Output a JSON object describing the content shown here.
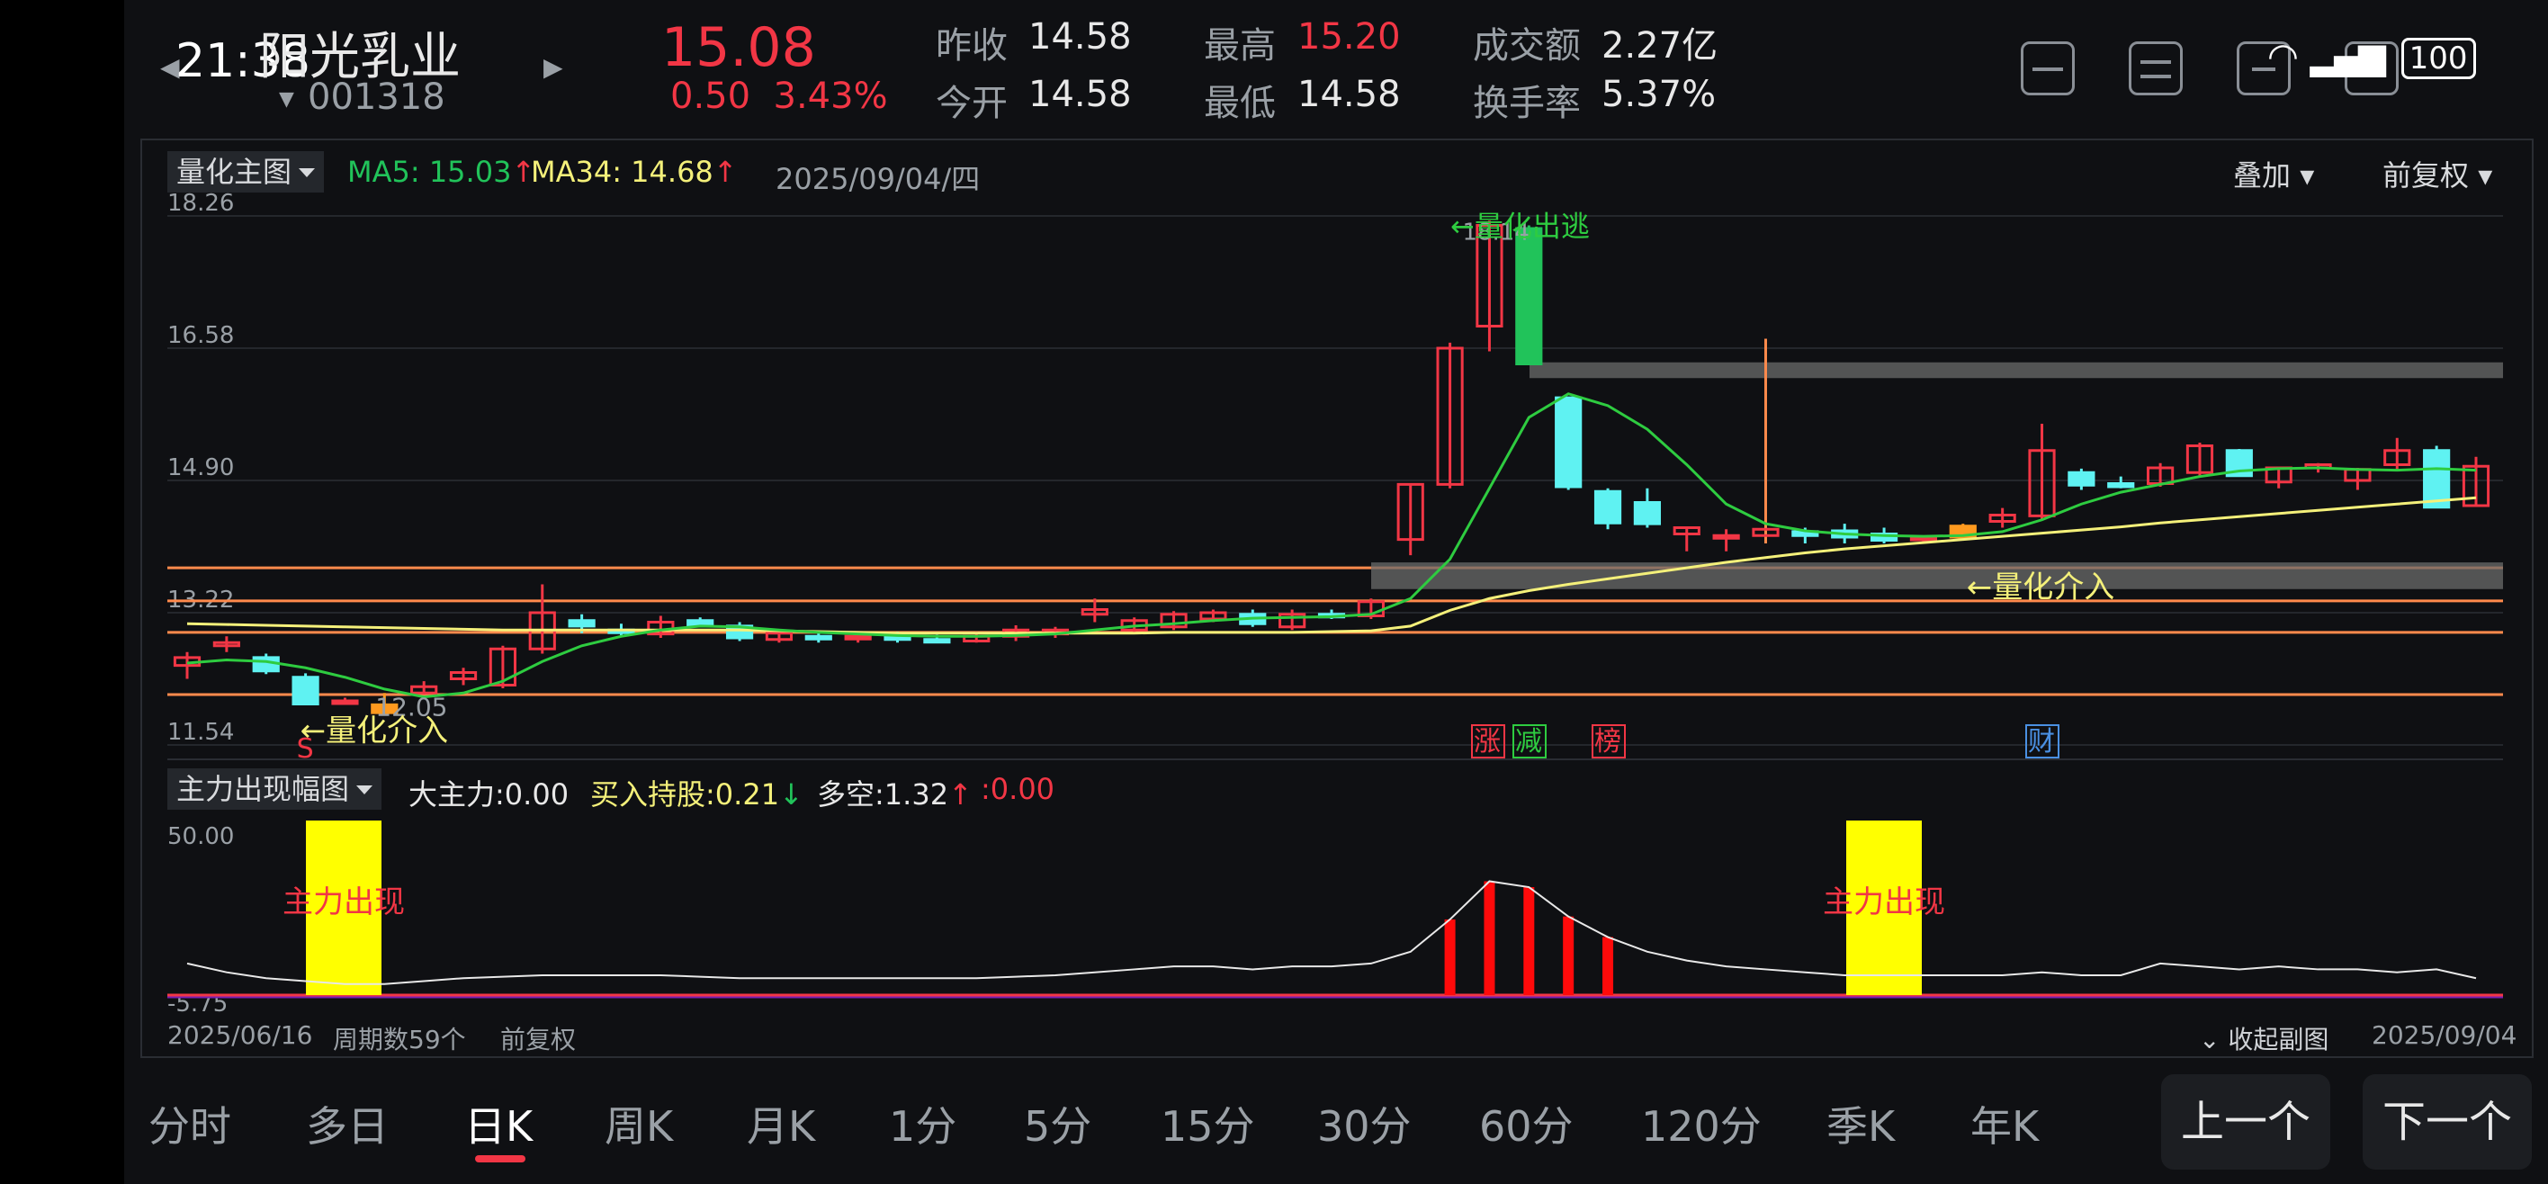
{
  "status": {
    "time": "21:38",
    "battery": "100"
  },
  "stock": {
    "name": "阳光乳业",
    "code": "001318",
    "price": "15.08",
    "change": "0.50",
    "change_pct": "3.43%"
  },
  "quote": {
    "prev_close_label": "昨收",
    "prev_close": "14.58",
    "open_label": "今开",
    "open": "14.58",
    "high_label": "最高",
    "high": "15.20",
    "low_label": "最低",
    "low": "14.58",
    "turnover_amt_label": "成交额",
    "turnover_amt": "2.27亿",
    "turnover_rate_label": "换手率",
    "turnover_rate": "5.37%"
  },
  "main_chart": {
    "indicator": "量化主图",
    "ma5_label": "MA5: 15.03",
    "ma5_arrow": "↑",
    "ma34_label": "MA34: 14.68",
    "ma34_arrow": "↑",
    "date": "2025/09/04/四",
    "overlay": "叠加",
    "adjust": "前复权",
    "y_ticks": [
      "18.26",
      "16.58",
      "14.90",
      "13.22",
      "11.54"
    ],
    "low_marker": "12.05",
    "high_marker": "18.14",
    "signal_buy": "←量化介入",
    "signal_sell": "←量化出逃",
    "s_marker": "S",
    "event_tags": [
      "涨",
      "减",
      "榜",
      "财"
    ]
  },
  "sub_chart": {
    "indicator": "主力出现幅图",
    "big_force_label": "大主力:",
    "big_force": "0.00",
    "buy_hold_label": "买入持股:",
    "buy_hold": "0.21",
    "buy_hold_arrow": "↓",
    "long_short_label": "多空:",
    "long_short": "1.32",
    "long_short_arrow": "↑",
    "extra": ":0.00",
    "y_top": "50.00",
    "y_bottom": "-5.75",
    "signal_text": "主力出现"
  },
  "footer": {
    "start_date": "2025/06/16",
    "periods": "周期数59个",
    "adjust": "前复权",
    "collapse": "收起副图",
    "end_date": "2025/09/04"
  },
  "tabs": [
    "分时",
    "多日",
    "日K",
    "周K",
    "月K",
    "1分",
    "5分",
    "15分",
    "30分",
    "60分",
    "120分",
    "季K",
    "年K"
  ],
  "nav": {
    "prev": "上一个",
    "next": "下一个"
  },
  "colors": {
    "up": "#f23645",
    "down": "#5ff2f2",
    "ma5": "#2ecc40",
    "ma34": "#f4f07a",
    "accent": "#f23645"
  },
  "chart_data": {
    "type": "candlestick",
    "x_range": [
      "2025/06/16",
      "2025/09/04"
    ],
    "periods": 59,
    "ylim": [
      11.54,
      18.26
    ],
    "candles": [
      {
        "o": 12.55,
        "h": 12.72,
        "l": 12.38,
        "c": 12.65
      },
      {
        "o": 12.8,
        "h": 12.92,
        "l": 12.72,
        "c": 12.84
      },
      {
        "o": 12.65,
        "h": 12.7,
        "l": 12.44,
        "c": 12.48
      },
      {
        "o": 12.4,
        "h": 12.45,
        "l": 12.06,
        "c": 12.06
      },
      {
        "o": 12.1,
        "h": 12.14,
        "l": 12.05,
        "c": 12.1
      },
      {
        "o": 12.05,
        "h": 12.2,
        "l": 12.0,
        "c": 11.95
      },
      {
        "o": 12.2,
        "h": 12.35,
        "l": 12.18,
        "c": 12.28
      },
      {
        "o": 12.38,
        "h": 12.52,
        "l": 12.3,
        "c": 12.46
      },
      {
        "o": 12.3,
        "h": 12.8,
        "l": 12.26,
        "c": 12.76
      },
      {
        "o": 12.76,
        "h": 13.58,
        "l": 12.7,
        "c": 13.22
      },
      {
        "o": 13.12,
        "h": 13.2,
        "l": 12.96,
        "c": 13.05
      },
      {
        "o": 13.0,
        "h": 13.08,
        "l": 12.92,
        "c": 12.98
      },
      {
        "o": 12.95,
        "h": 13.18,
        "l": 12.9,
        "c": 13.1
      },
      {
        "o": 13.12,
        "h": 13.16,
        "l": 13.04,
        "c": 13.06
      },
      {
        "o": 13.05,
        "h": 13.1,
        "l": 12.86,
        "c": 12.9
      },
      {
        "o": 12.88,
        "h": 13.0,
        "l": 12.84,
        "c": 12.96
      },
      {
        "o": 12.92,
        "h": 12.98,
        "l": 12.84,
        "c": 12.9
      },
      {
        "o": 12.9,
        "h": 12.96,
        "l": 12.84,
        "c": 12.92
      },
      {
        "o": 12.92,
        "h": 12.98,
        "l": 12.84,
        "c": 12.88
      },
      {
        "o": 12.88,
        "h": 12.94,
        "l": 12.84,
        "c": 12.86
      },
      {
        "o": 12.86,
        "h": 12.98,
        "l": 12.84,
        "c": 12.92
      },
      {
        "o": 12.92,
        "h": 13.06,
        "l": 12.86,
        "c": 13.0
      },
      {
        "o": 12.95,
        "h": 13.04,
        "l": 12.9,
        "c": 13.0
      },
      {
        "o": 13.2,
        "h": 13.4,
        "l": 13.1,
        "c": 13.26
      },
      {
        "o": 13.0,
        "h": 13.16,
        "l": 12.96,
        "c": 13.12
      },
      {
        "o": 13.04,
        "h": 13.24,
        "l": 13.0,
        "c": 13.2
      },
      {
        "o": 13.14,
        "h": 13.26,
        "l": 13.1,
        "c": 13.22
      },
      {
        "o": 13.2,
        "h": 13.26,
        "l": 13.04,
        "c": 13.08
      },
      {
        "o": 13.04,
        "h": 13.26,
        "l": 13.0,
        "c": 13.2
      },
      {
        "o": 13.2,
        "h": 13.26,
        "l": 13.14,
        "c": 13.18
      },
      {
        "o": 13.18,
        "h": 13.4,
        "l": 13.14,
        "c": 13.36
      },
      {
        "o": 14.15,
        "h": 14.85,
        "l": 13.95,
        "c": 14.85
      },
      {
        "o": 14.85,
        "h": 16.65,
        "l": 14.8,
        "c": 16.58
      },
      {
        "o": 16.86,
        "h": 18.2,
        "l": 16.54,
        "c": 18.14
      },
      {
        "o": 18.1,
        "h": 18.14,
        "l": 16.38,
        "c": 16.38
      },
      {
        "o": 15.95,
        "h": 15.95,
        "l": 14.78,
        "c": 14.82
      },
      {
        "o": 14.76,
        "h": 14.8,
        "l": 14.28,
        "c": 14.36
      },
      {
        "o": 14.62,
        "h": 14.8,
        "l": 14.3,
        "c": 14.35
      },
      {
        "o": 14.22,
        "h": 14.3,
        "l": 14.0,
        "c": 14.3
      },
      {
        "o": 14.2,
        "h": 14.28,
        "l": 14.0,
        "c": 14.2
      },
      {
        "o": 14.2,
        "h": 16.7,
        "l": 14.1,
        "c": 14.28
      },
      {
        "o": 14.25,
        "h": 14.3,
        "l": 14.1,
        "c": 14.2
      },
      {
        "o": 14.26,
        "h": 14.35,
        "l": 14.1,
        "c": 14.18
      },
      {
        "o": 14.22,
        "h": 14.3,
        "l": 14.1,
        "c": 14.14
      },
      {
        "o": 14.18,
        "h": 14.2,
        "l": 14.1,
        "c": 14.18
      },
      {
        "o": 14.18,
        "h": 14.35,
        "l": 14.15,
        "c": 14.32
      },
      {
        "o": 14.38,
        "h": 14.55,
        "l": 14.3,
        "c": 14.46
      },
      {
        "o": 14.45,
        "h": 15.62,
        "l": 14.4,
        "c": 15.28
      },
      {
        "o": 15.0,
        "h": 15.05,
        "l": 14.78,
        "c": 14.84
      },
      {
        "o": 14.86,
        "h": 14.95,
        "l": 14.8,
        "c": 14.82
      },
      {
        "o": 14.86,
        "h": 15.12,
        "l": 14.82,
        "c": 15.06
      },
      {
        "o": 15.0,
        "h": 15.38,
        "l": 14.95,
        "c": 15.34
      },
      {
        "o": 15.28,
        "h": 15.3,
        "l": 14.95,
        "c": 14.96
      },
      {
        "o": 14.88,
        "h": 15.06,
        "l": 14.8,
        "c": 15.06
      },
      {
        "o": 15.06,
        "h": 15.12,
        "l": 15.0,
        "c": 15.1
      },
      {
        "o": 14.9,
        "h": 15.06,
        "l": 14.78,
        "c": 15.04
      },
      {
        "o": 15.1,
        "h": 15.44,
        "l": 15.04,
        "c": 15.28
      },
      {
        "o": 15.28,
        "h": 15.34,
        "l": 14.56,
        "c": 14.56
      },
      {
        "o": 14.58,
        "h": 15.2,
        "l": 14.58,
        "c": 15.08
      }
    ],
    "ma5": [
      12.58,
      12.62,
      12.6,
      12.52,
      12.4,
      12.25,
      12.15,
      12.2,
      12.35,
      12.6,
      12.8,
      12.92,
      13.0,
      13.05,
      13.04,
      13.0,
      12.97,
      12.95,
      12.93,
      12.92,
      12.92,
      12.93,
      12.95,
      13.0,
      13.05,
      13.08,
      13.12,
      13.15,
      13.16,
      13.17,
      13.2,
      13.4,
      13.9,
      14.8,
      15.7,
      16.0,
      15.85,
      15.55,
      15.1,
      14.6,
      14.35,
      14.26,
      14.22,
      14.2,
      14.19,
      14.2,
      14.25,
      14.4,
      14.6,
      14.75,
      14.85,
      14.95,
      15.02,
      15.05,
      15.06,
      15.04,
      15.03,
      15.05,
      15.03
    ],
    "ma34": [
      13.08,
      13.07,
      13.06,
      13.05,
      13.04,
      13.03,
      13.02,
      13.01,
      13.0,
      13.0,
      13.0,
      13.0,
      13.0,
      13.0,
      13.0,
      12.99,
      12.98,
      12.97,
      12.96,
      12.96,
      12.96,
      12.96,
      12.96,
      12.96,
      12.96,
      12.97,
      12.97,
      12.97,
      12.97,
      12.98,
      12.99,
      13.05,
      13.25,
      13.4,
      13.5,
      13.58,
      13.65,
      13.72,
      13.79,
      13.86,
      13.92,
      13.98,
      14.03,
      14.07,
      14.11,
      14.15,
      14.19,
      14.23,
      14.27,
      14.31,
      14.36,
      14.4,
      14.44,
      14.48,
      14.52,
      14.56,
      14.6,
      14.64,
      14.68
    ],
    "support_levels": [
      13.79,
      13.37,
      12.97,
      12.18
    ],
    "sub_values": [
      5,
      2,
      0,
      -1,
      -2,
      -2,
      -1,
      0,
      0.5,
      1,
      1,
      1,
      1,
      0.5,
      0,
      0,
      0,
      0,
      0,
      0,
      0,
      0.5,
      1,
      2,
      3,
      4,
      4,
      3,
      4,
      4,
      5,
      9,
      20,
      33,
      31,
      21,
      14,
      9,
      6,
      4,
      3,
      2,
      1,
      1,
      1,
      1,
      1,
      2,
      1,
      1,
      5,
      4,
      3,
      4,
      3,
      3,
      2,
      3,
      0
    ],
    "sub_bars": [
      32,
      33,
      34,
      35,
      36
    ]
  }
}
